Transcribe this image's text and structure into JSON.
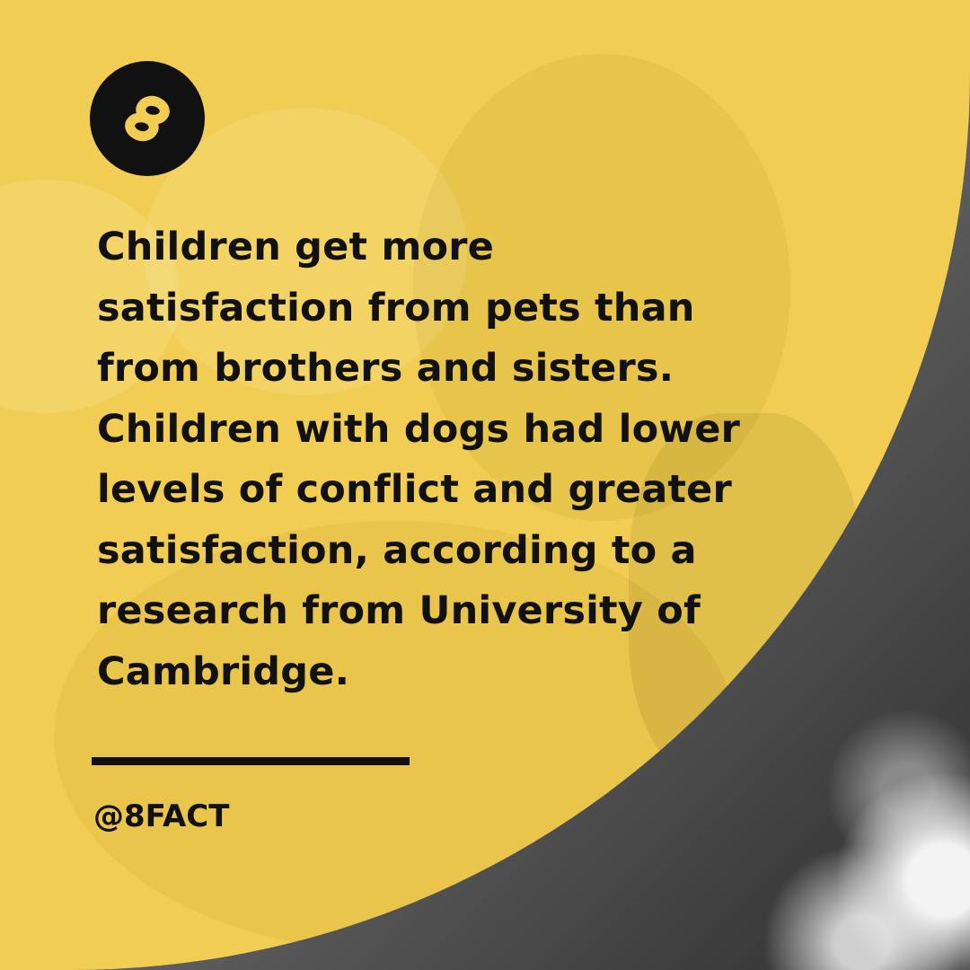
{
  "brand": {
    "logo_icon": "infinity-8-icon",
    "handle": "@8FACT"
  },
  "headline": {
    "lines": [
      "Children get more",
      "satisfaction from pets than",
      "from brothers and sisters.",
      "Children with dogs had lower",
      "levels of conflict and greater",
      "satisfaction, according to a",
      "research from University of",
      "Cambridge."
    ]
  },
  "colors": {
    "accent_yellow": "#f1ce53",
    "ink": "#111111"
  }
}
